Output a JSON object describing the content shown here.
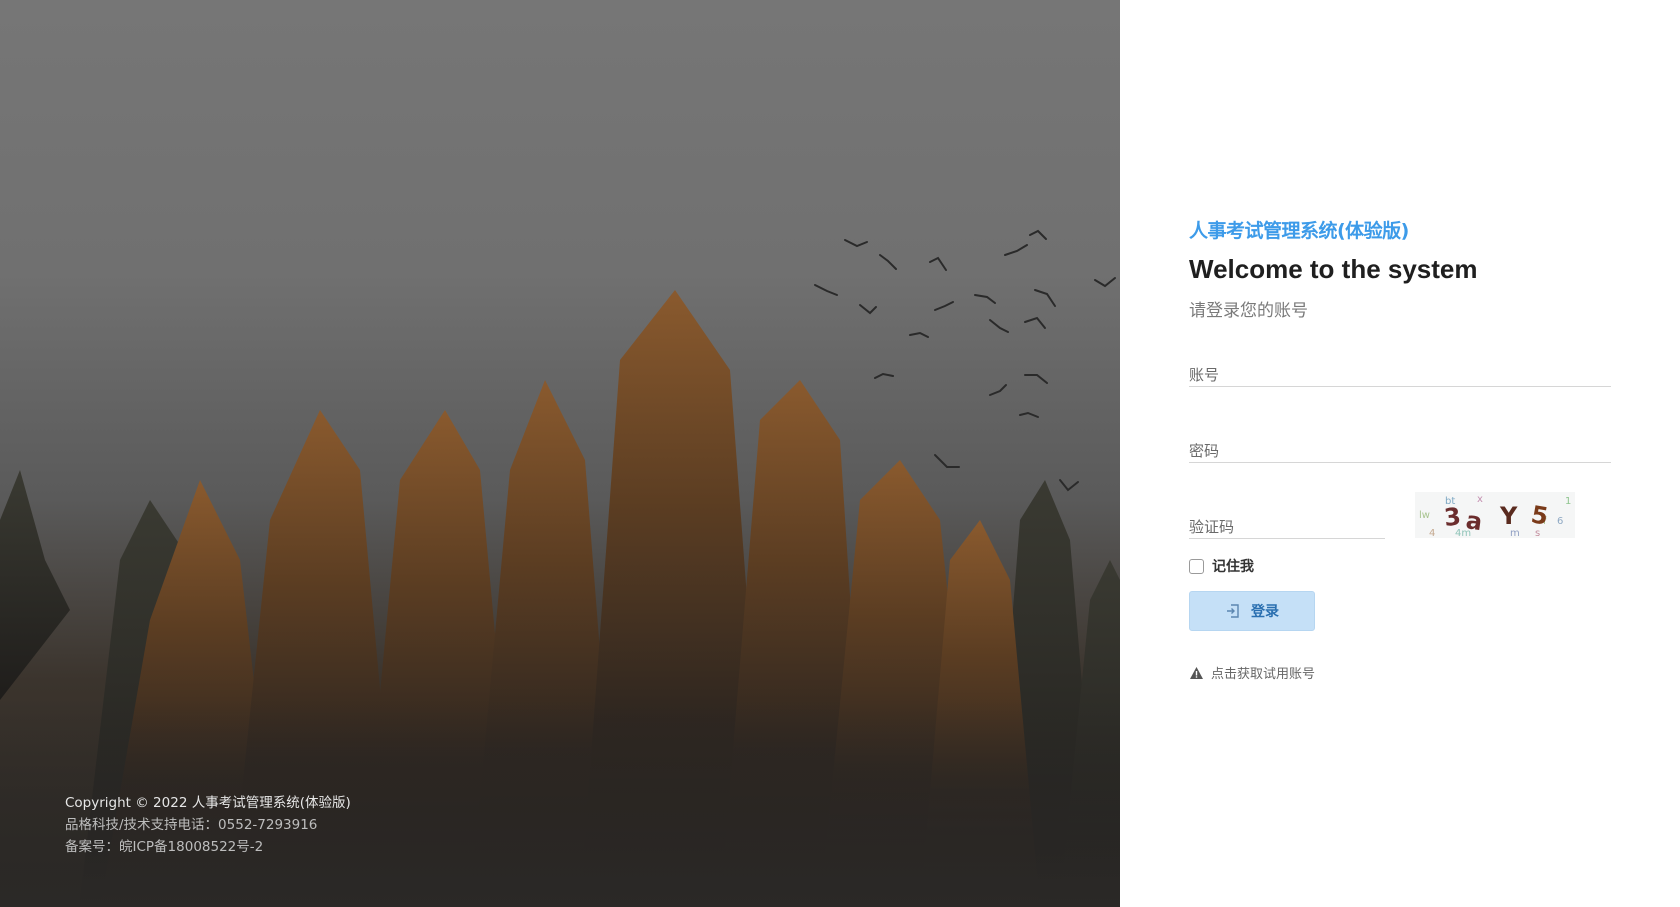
{
  "footer": {
    "copyright": "Copyright © 2022 人事考试管理系统(体验版)",
    "support": "品格科技/技术支持电话：0552-7293916",
    "icp": "备案号：皖ICP备18008522号-2"
  },
  "login": {
    "system_title": "人事考试管理系统(体验版)",
    "welcome": "Welcome to the system",
    "subtitle": "请登录您的账号",
    "account_placeholder": "账号",
    "password_placeholder": "密码",
    "captcha_placeholder": "验证码",
    "captcha_text": "3a Y 5",
    "remember_label": "记住我",
    "login_button": "登录",
    "trial_link": "点击获取试用账号"
  },
  "colors": {
    "accent": "#3d9be9",
    "button_bg": "#c5e0f7",
    "button_text": "#2a6fb0"
  },
  "icons": {
    "login": "login-arrow-icon",
    "warning": "warning-triangle-icon"
  }
}
